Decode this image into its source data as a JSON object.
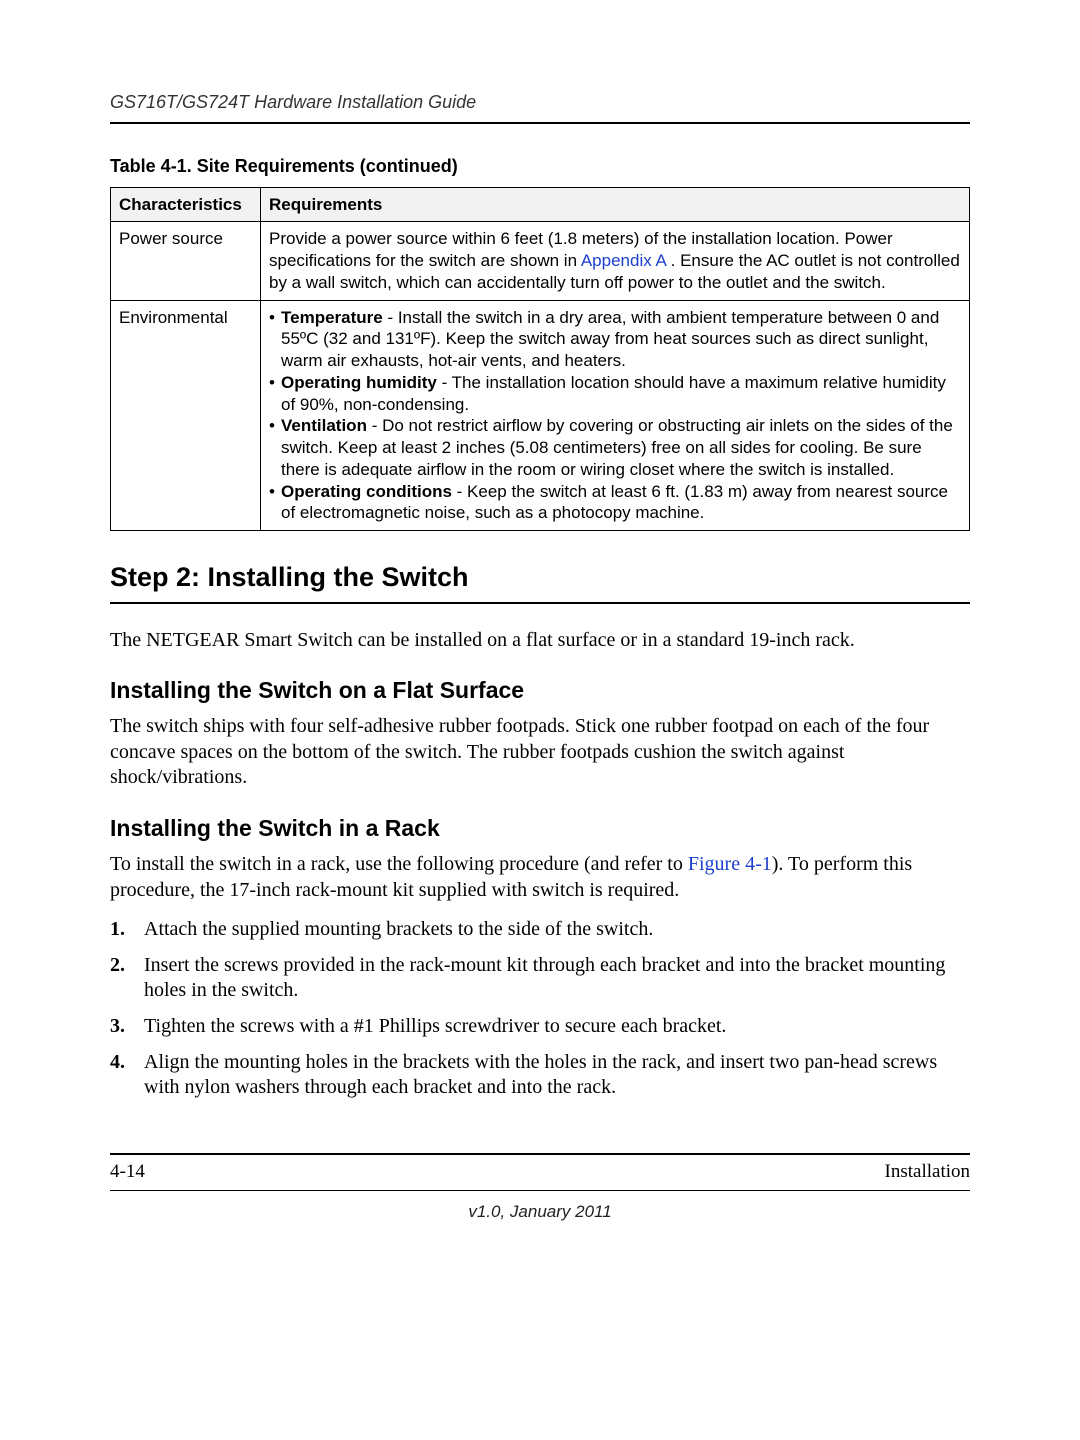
{
  "header": {
    "running": "GS716T/GS724T Hardware Installation Guide"
  },
  "table": {
    "caption": "Table 4-1.  Site Requirements (continued)",
    "headers": {
      "col1": "Characteristics",
      "col2": "Requirements"
    },
    "rows": {
      "power": {
        "char": "Power source",
        "req_pre": "Provide a power source within 6 feet (1.8 meters) of the installation location. Power specifications for the switch are shown in ",
        "req_link": "Appendix A",
        "req_post": " . Ensure the AC outlet is not controlled by a wall switch, which can accidentally turn off power to the outlet and the switch."
      },
      "env": {
        "char": "Environmental",
        "items": {
          "temperature": {
            "label": "Temperature",
            "text": " - Install the switch in a dry area, with ambient temperature between 0 and 55ºC (32 and 131ºF). Keep the switch away from heat sources such as direct sunlight, warm air exhausts, hot-air vents, and heaters."
          },
          "humidity": {
            "label": "Operating humidity",
            "text": " - The installation location should have a maximum relative humidity of 90%, non-condensing."
          },
          "ventilation": {
            "label": "Ventilation",
            "text": " - Do not restrict airflow by covering or obstructing air inlets on the sides of the switch. Keep at least 2 inches (5.08 centimeters) free on all sides for cooling. Be sure there is adequate airflow in the room or wiring closet where the switch is installed."
          },
          "operating": {
            "label": "Operating conditions",
            "text": " - Keep the switch at least 6 ft. (1.83 m) away from nearest source of electromagnetic noise, such as a photocopy machine."
          }
        }
      }
    }
  },
  "step2": {
    "title": "Step 2: Installing the Switch",
    "intro": "The NETGEAR Smart Switch can be installed on a flat surface or in a standard 19-inch rack.",
    "flat": {
      "title": "Installing the Switch on a Flat Surface",
      "text": "The switch ships with four self-adhesive rubber footpads. Stick one rubber footpad on each of the four concave spaces on the bottom of the switch. The rubber footpads cushion the switch against shock/vibrations."
    },
    "rack": {
      "title": "Installing the Switch in a Rack",
      "intro_pre": "To install the switch in a rack, use the following procedure (and refer to ",
      "intro_link": "Figure 4-1",
      "intro_post": "). To perform this procedure, the 17-inch rack-mount kit supplied with switch is required.",
      "steps": {
        "s1": "Attach the supplied mounting brackets to the side of the switch.",
        "s2": "Insert the screws provided in the rack-mount kit through each bracket and into the bracket mounting holes in the switch.",
        "s3": "Tighten the screws with a #1 Phillips screwdriver to secure each bracket.",
        "s4": "Align the mounting holes in the brackets with the holes in the rack, and insert two pan-head screws with nylon washers through each bracket and into the rack."
      }
    }
  },
  "footer": {
    "page": "4-14",
    "section": "Installation",
    "version": "v1.0, January 2011"
  }
}
